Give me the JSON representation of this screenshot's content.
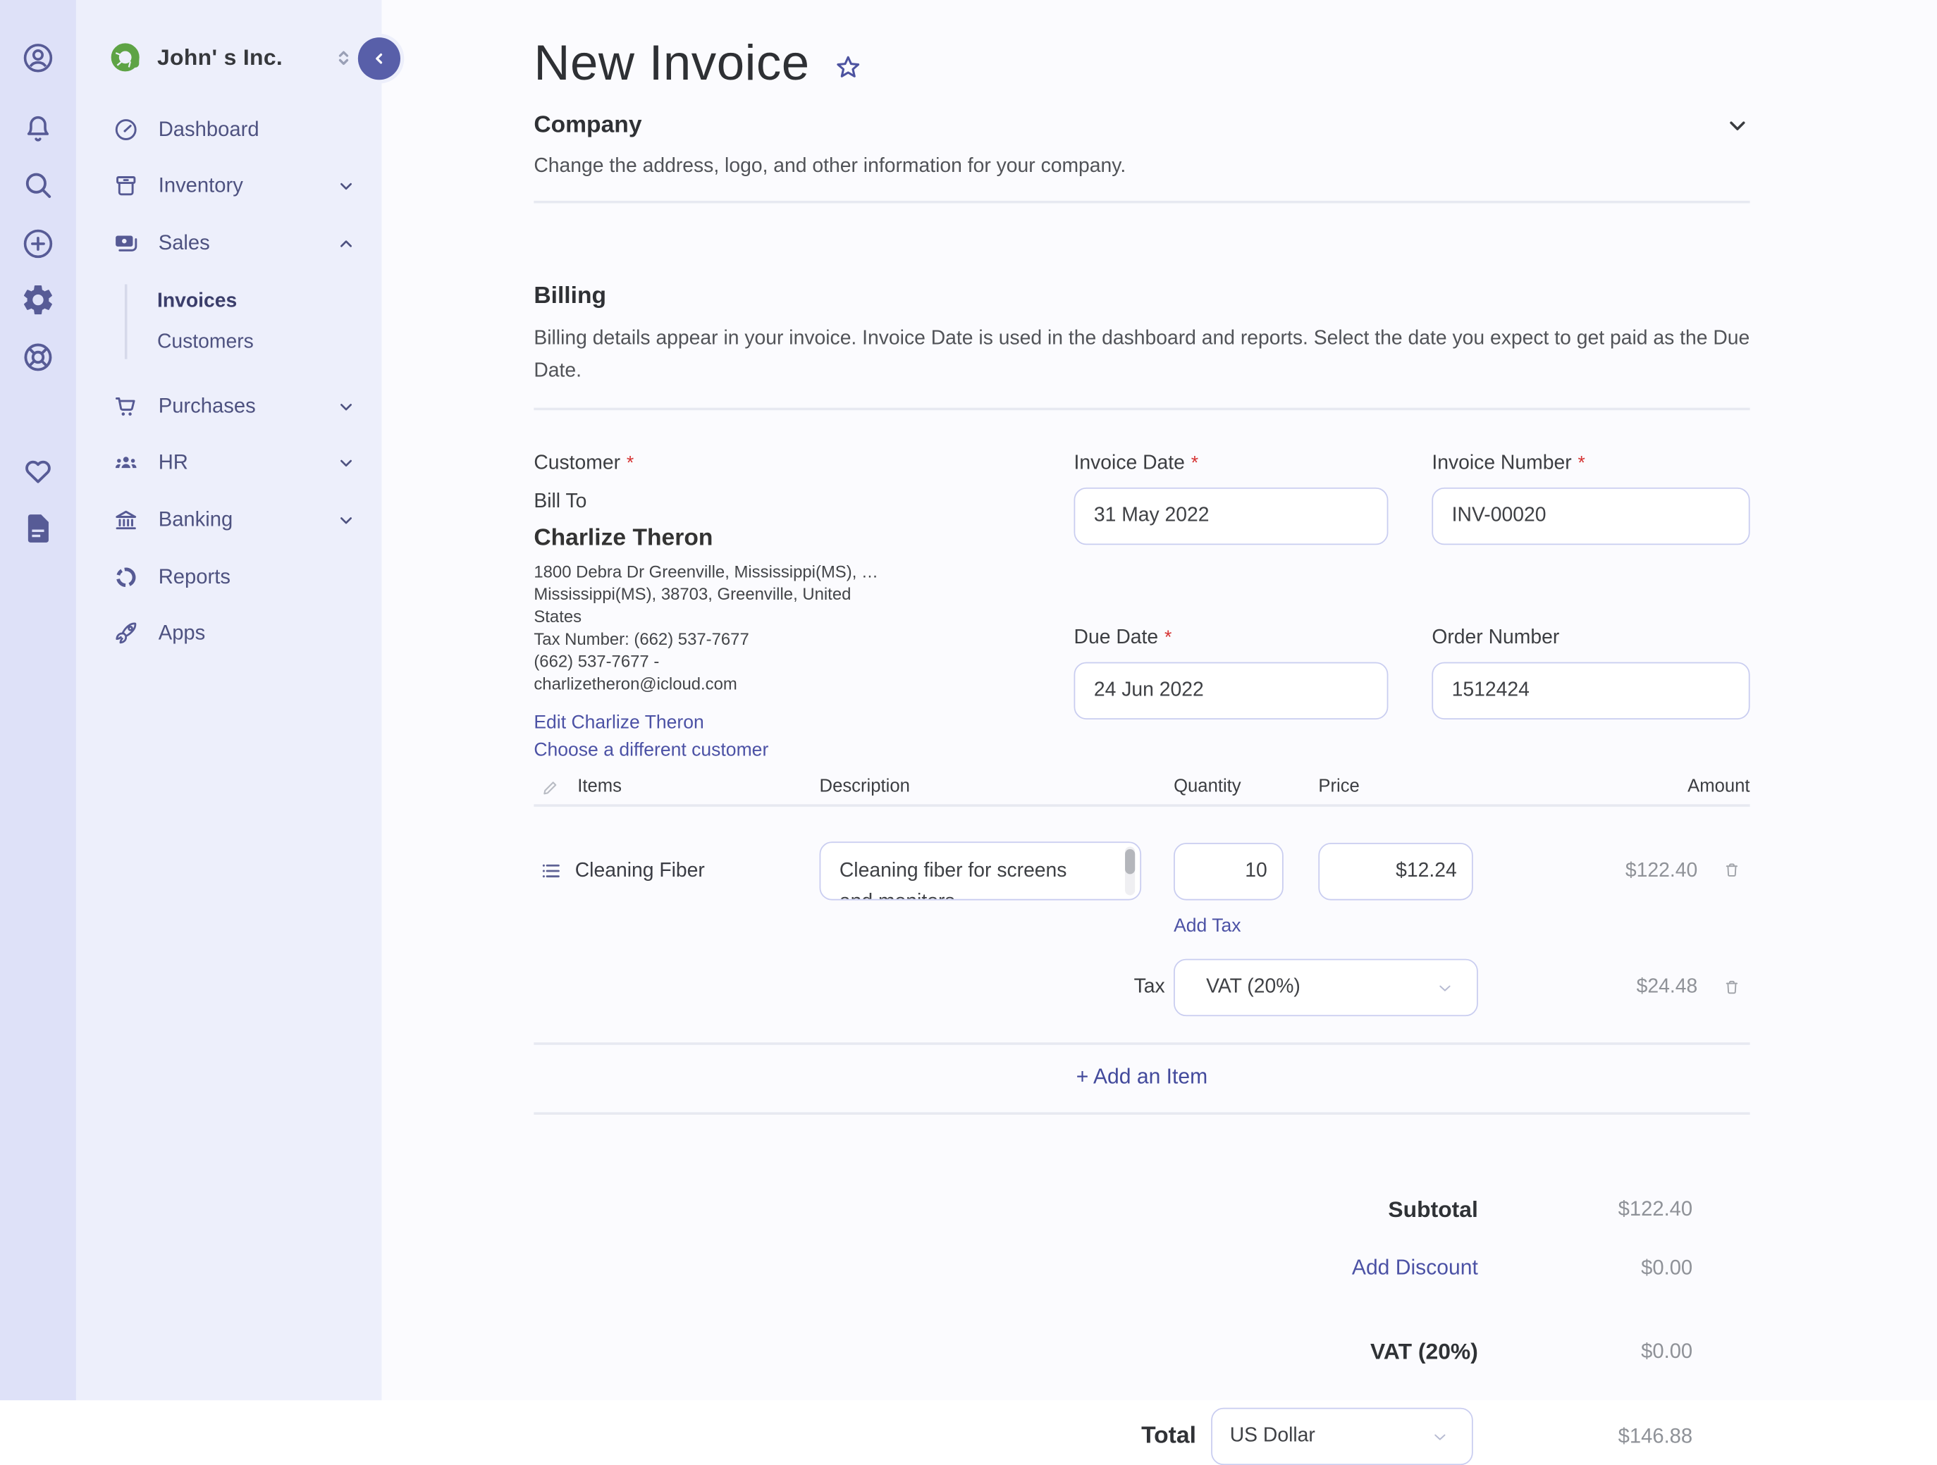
{
  "app": {
    "company_name": "John' s Inc.",
    "colors": {
      "accent_indigo": "#4c52a5",
      "rail_bg": "#dee1f8",
      "sidebar_bg": "#edeffb",
      "logo_green": "#5ea345",
      "required_red": "#d63434"
    },
    "rail_icons": [
      "account-icon",
      "bell-icon",
      "search-icon",
      "plus-circle-icon",
      "gear-icon",
      "lifebuoy-icon",
      "heart-icon",
      "document-icon"
    ]
  },
  "required_marker": "*",
  "sidebar": {
    "items": [
      {
        "label": "Dashboard",
        "icon": "dashboard-icon"
      },
      {
        "label": "Inventory",
        "icon": "inventory-icon",
        "chevron": "down"
      },
      {
        "label": "Sales",
        "icon": "sales-icon",
        "chevron": "up",
        "children": [
          "Invoices",
          "Customers"
        ]
      },
      {
        "label": "Purchases",
        "icon": "cart-icon",
        "chevron": "down"
      },
      {
        "label": "HR",
        "icon": "people-icon",
        "chevron": "down"
      },
      {
        "label": "Banking",
        "icon": "bank-icon",
        "chevron": "down"
      },
      {
        "label": "Reports",
        "icon": "pie-chart-icon"
      },
      {
        "label": "Apps",
        "icon": "rocket-icon"
      }
    ]
  },
  "header": {
    "title": "New Invoice"
  },
  "company_section": {
    "title": "Company",
    "description": "Change the address, logo, and other information for your company."
  },
  "billing_section": {
    "title": "Billing",
    "description": "Billing details appear in your invoice. Invoice Date is used in the dashboard and reports. Select the date you expect to get paid as the Due Date."
  },
  "customer": {
    "label": "Customer",
    "bill_to": "Bill To",
    "name": "Charlize Theron",
    "address_lines": [
      "1800 Debra Dr Greenville, Mississippi(MS),  …",
      "Mississippi(MS), 38703, Greenville, United",
      "States"
    ],
    "tax_number": "Tax Number: (662) 537-7677",
    "phone": "(662) 537-7677  -",
    "email": "charlizetheron@icloud.com",
    "edit_link": "Edit Charlize Theron",
    "choose_link": "Choose a different customer"
  },
  "fields": {
    "invoice_date": {
      "label": "Invoice Date",
      "value": "31 May 2022"
    },
    "invoice_number": {
      "label": "Invoice Number",
      "value": "INV-00020"
    },
    "due_date": {
      "label": "Due Date",
      "value": "24 Jun 2022"
    },
    "order_number": {
      "label": "Order Number",
      "value": "1512424"
    }
  },
  "items_table": {
    "headers": [
      "Items",
      "Description",
      "Quantity",
      "Price",
      "Amount"
    ],
    "rows": [
      {
        "name": "Cleaning Fiber",
        "description": "Cleaning fiber for screens and monitors",
        "quantity": "10",
        "price": "$12.24",
        "amount": "$122.40"
      }
    ],
    "add_tax_label": "Add Tax",
    "tax_row": {
      "label": "Tax",
      "value": "VAT (20%)",
      "amount": "$24.48"
    },
    "add_item_label": "+ Add an Item"
  },
  "totals": {
    "rows": [
      {
        "label": "Subtotal",
        "value": "$122.40"
      },
      {
        "label": "Add Discount",
        "value": "$0.00"
      },
      {
        "label": "VAT (20%)",
        "value": "$0.00"
      }
    ],
    "total_label": "Total",
    "currency": "US Dollar",
    "total_value": "$146.88"
  }
}
